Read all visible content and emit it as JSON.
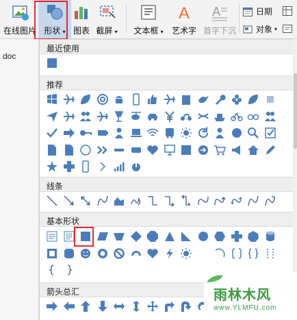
{
  "ribbon": {
    "online_picture": "在线图片",
    "shapes": "形状",
    "chart": "图表",
    "screenshot": "截屏",
    "textbox": "文本框",
    "wordart": "艺术字",
    "drop_cap": "首字下沉",
    "date": "日期",
    "object": "对象"
  },
  "doc": {
    "name": "doc"
  },
  "panel": {
    "sections": {
      "recent": "最近使用",
      "recommended": "推荐",
      "lines": "线条",
      "basic": "基本形状",
      "arrows": "箭头总汇"
    }
  },
  "watermark": {
    "title": "雨林木风",
    "url": "www.YLMFU.com"
  },
  "colors": {
    "accent": "#4a7ebb",
    "highlight": "#e02b2b"
  },
  "icons": {
    "recent": [
      "rectangle"
    ],
    "recommended": [
      "windows",
      "plane",
      "leaf",
      "at",
      "android",
      "phone",
      "thumbs-up",
      "plane",
      "building",
      "bird",
      "wrench",
      "flower",
      "leaf",
      "unknown",
      "send",
      "plane",
      "people",
      "plane",
      "lamp",
      "helicopter",
      "car",
      "yen",
      "motorcycle",
      "ribbon",
      "ship",
      "bicycle",
      "glasses",
      "people",
      "check",
      "arrow-right",
      "key",
      "battery",
      "person",
      "laptop",
      "wifi",
      "bus",
      "sun",
      "refresh",
      "person",
      "circle",
      "magnifier",
      "checkbox",
      "document",
      "document",
      "circle-outline",
      "chevrons",
      "minus",
      "train",
      "heart",
      "monitor",
      "rectangle",
      "arrow-circle",
      "cart",
      "megaphone",
      "home",
      "pencil",
      "star",
      "cross",
      "phone",
      "chevron",
      "signal",
      "power"
    ],
    "lines": [
      "line",
      "arrow-line",
      "double-arrow-line",
      "curve",
      "freeform",
      "scribble",
      "elbow",
      "elbow-arrow",
      "elbow-double-arrow",
      "step",
      "step-arrow",
      "step-double",
      "curve",
      "curve-arrow"
    ],
    "basic": [
      "textbox",
      "vertical-textbox",
      "rectangle",
      "parallelogram",
      "trapezoid",
      "diamond",
      "octagon",
      "triangle",
      "right-triangle",
      "circle",
      "hexagon",
      "cross",
      "heptagon",
      "cylinder",
      "frame",
      "plaque",
      "smiley",
      "donut",
      "no-symbol",
      "block-arc",
      "heart",
      "lightning",
      "sun",
      "moon",
      "arc",
      "bracket",
      "brace",
      "double-bracket",
      "brace-left",
      "brace-right"
    ],
    "arrows": [
      "arrow-right",
      "arrow-left",
      "arrow-up",
      "arrow-down",
      "arrow-left-right",
      "arrow-up-down",
      "quad-arrow",
      "arrow-bend",
      "arrow-uturn",
      "arrow-circ",
      "arrow-notch",
      "arrow-chevron",
      "arrow",
      "arrow"
    ]
  }
}
